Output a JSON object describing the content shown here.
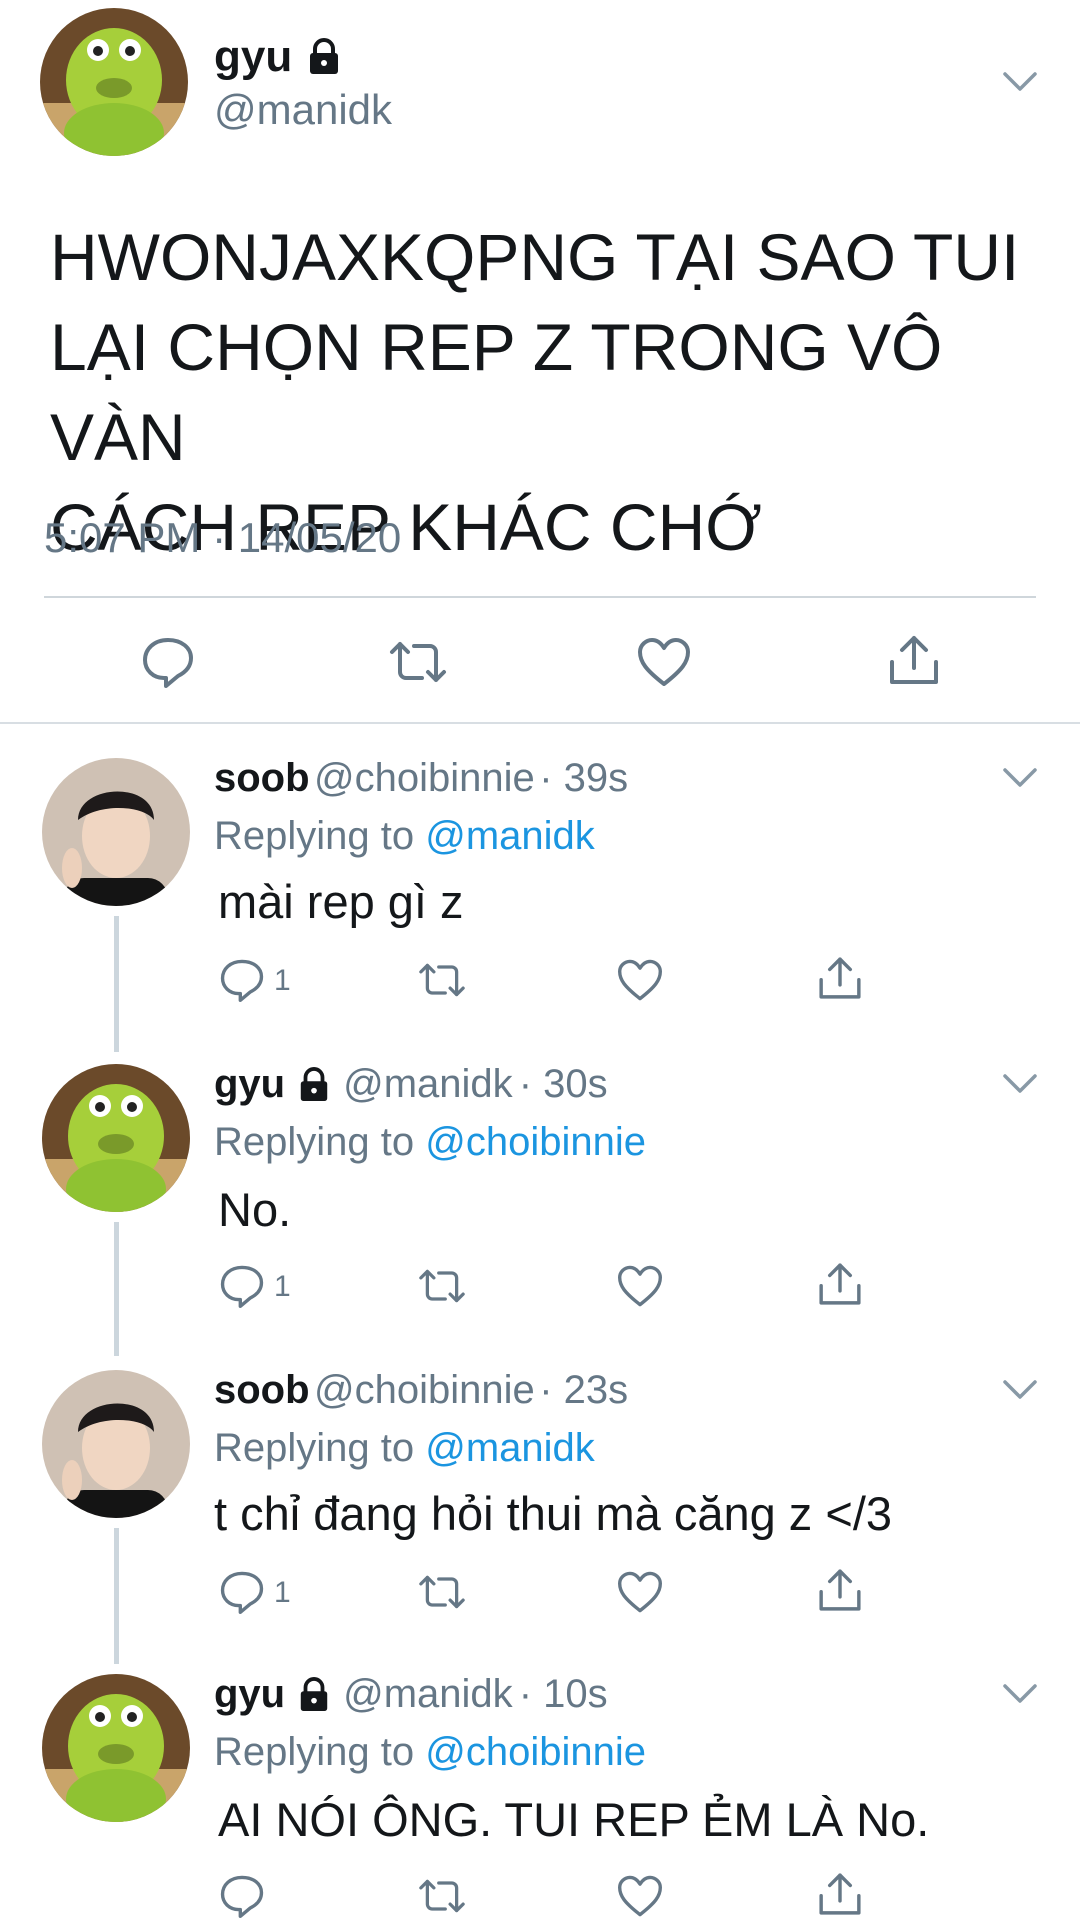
{
  "tweet": {
    "name": "gyu",
    "handle": "@manidk",
    "text_lines": [
      "HWONJAXKQPNG TẠI SAO TUI",
      "LẠI CHỌN REP Z TRONG VÔ VÀN",
      "CÁCH REP KHÁC CHỚ"
    ],
    "timestamp": "5:07 PM · 14/05/20"
  },
  "replies": [
    {
      "name": "soob",
      "handle": "@choibinnie",
      "time": "· 39s",
      "replying_prefix": "Replying to",
      "replying_to": "@manidk",
      "text": "mài rep gì z",
      "reply_count": "1"
    },
    {
      "name": "gyu",
      "handle": "@manidk",
      "time": "· 30s",
      "replying_prefix": "Replying to",
      "replying_to": "@choibinnie",
      "text": "No.",
      "reply_count": "1"
    },
    {
      "name": "soob",
      "handle": "@choibinnie",
      "time": "· 23s",
      "replying_prefix": "Replying to",
      "replying_to": "@manidk",
      "text": "t chỉ đang hỏi thui mà căng z </3",
      "reply_count": "1"
    },
    {
      "name": "gyu",
      "handle": "@manidk",
      "time": "· 10s",
      "replying_prefix": "Replying to",
      "replying_to": "@choibinnie",
      "text": "AI NÓI ÔNG. TUI REP ẺM LÀ No.",
      "reply_count": ""
    }
  ],
  "colors": {
    "link": "#1b95e0",
    "muted": "#657786",
    "text": "#14171a",
    "line": "#ccd6dd"
  },
  "icons": [
    "lock-icon",
    "chevron-down-icon",
    "reply-icon",
    "retweet-icon",
    "like-icon",
    "share-icon"
  ]
}
